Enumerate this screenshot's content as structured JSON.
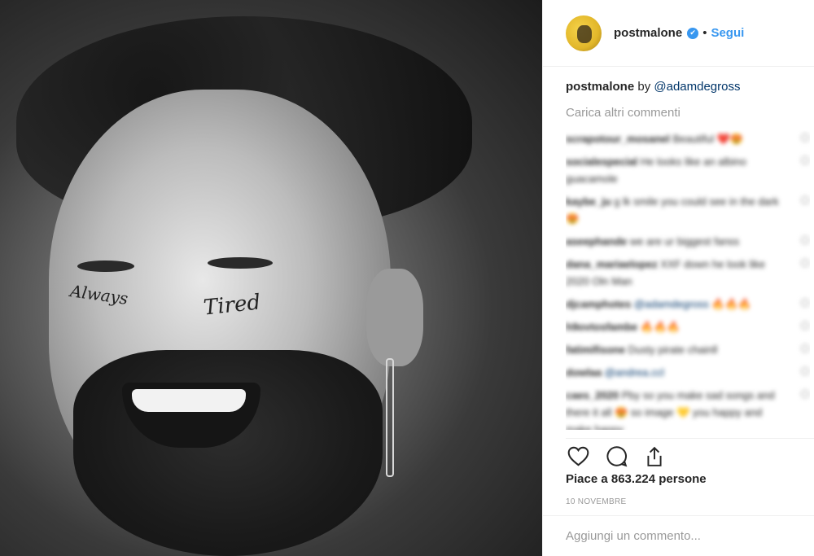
{
  "post": {
    "username": "postmalone",
    "separator": "•",
    "follow_label": "Segui"
  },
  "caption": {
    "user": "postmalone",
    "by": "by",
    "mention": "@adamdegross"
  },
  "load_more": "Carica altri commenti",
  "comments": [
    {
      "user": "scrapotour_mosanel",
      "text": "Beautiful ❤️😍"
    },
    {
      "user": "socialespecial",
      "text": "He looks like an albino guacamole"
    },
    {
      "user": "kaybe_ju",
      "text": "g lk smile you could see in the dark 😍"
    },
    {
      "user": "aseephande",
      "text": "we are ur biggest fanss"
    },
    {
      "user": "dana_mariaelopez",
      "text": "XXF down he look like 2020 Oln Man"
    },
    {
      "user": "djcamphotes",
      "text": "@adamdegross 🔥🔥🔥"
    },
    {
      "user": "h9ovtosfambe",
      "text": "🔥🔥🔥"
    },
    {
      "user": "fatimifisone",
      "text": "Dusty pirate chainll"
    },
    {
      "user": "dowlaa",
      "text": "@andrea.ccl"
    },
    {
      "user": "caes_2020",
      "text": "Pby so you make sad songs and there it all 😍 so image 💛 you happy and make happy"
    }
  ],
  "likes_label": "Piace a 863.224 persone",
  "date_label": "10 NOVEMBRE",
  "add_comment_placeholder": "Aggiungi un commento...",
  "photo": {
    "tattoo_tired": "Tired",
    "tattoo_always": "Always"
  },
  "colors": {
    "accent_blue": "#3897f0",
    "mention_blue": "#003569",
    "muted_gray": "#999999",
    "divider": "#efefef"
  },
  "icons": [
    "heart-icon",
    "comment-icon",
    "share-icon",
    "verified-badge-icon"
  ]
}
